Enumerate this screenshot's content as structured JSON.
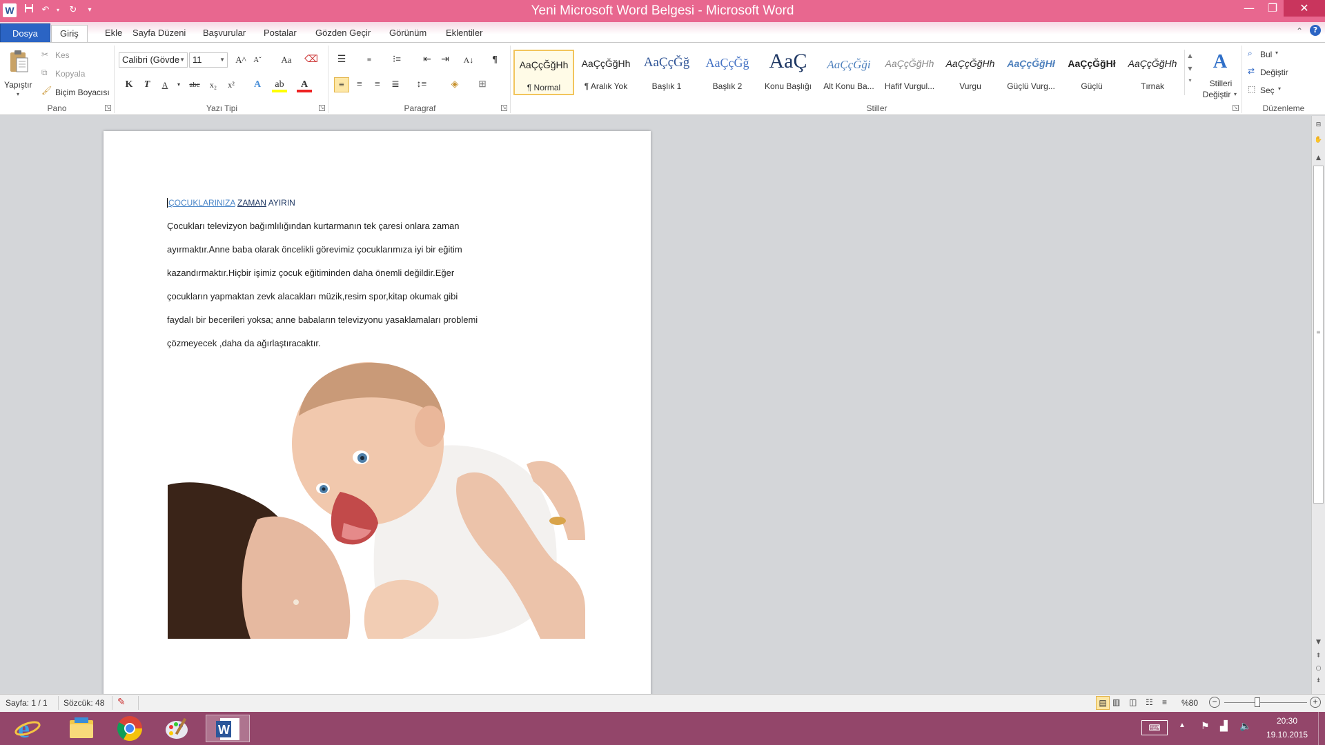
{
  "window": {
    "title": "Yeni Microsoft Word Belgesi  -  Microsoft Word",
    "app_logo": "W",
    "quick_access": [
      "save-icon",
      "undo-icon",
      "redo-icon",
      "customize-icon"
    ],
    "controls": [
      "minimize-icon",
      "restore-icon",
      "close-icon"
    ]
  },
  "tabs": {
    "file": "Dosya",
    "items": [
      "Giriş",
      "Ekle",
      "Sayfa Düzeni",
      "Başvurular",
      "Postalar",
      "Gözden Geçir",
      "Görünüm",
      "Eklentiler"
    ]
  },
  "ribbon": {
    "clipboard": {
      "label": "Pano",
      "paste": "Yapıştır",
      "cut": "Kes",
      "copy": "Kopyala",
      "format_painter": "Biçim Boyacısı"
    },
    "font": {
      "label": "Yazı Tipi",
      "family": "Calibri (Gövde",
      "size": "11",
      "bold": "K",
      "italic": "T",
      "underline": "A",
      "strike": "abc",
      "subscript": "x₂",
      "superscript": "x²",
      "grow": "A^",
      "shrink": "Aˇ",
      "case": "Aa"
    },
    "paragraph": {
      "label": "Paragraf",
      "pilcrow": "¶"
    },
    "styles": {
      "label": "Stiller",
      "items": [
        {
          "sample": "AaÇçĞğHh",
          "name": "¶ Normal",
          "selected": true
        },
        {
          "sample": "AaÇçĞğHh",
          "name": "¶ Aralık Yok"
        },
        {
          "sample": "AaÇçĞğ",
          "name": "Başlık 1"
        },
        {
          "sample": "AaÇçĞğ",
          "name": "Başlık 2"
        },
        {
          "sample": "AaÇ",
          "name": "Konu Başlığı"
        },
        {
          "sample": "AaÇçĞği",
          "name": "Alt Konu Ba..."
        },
        {
          "sample": "AaÇçĞğHh",
          "name": "Hafif Vurgul..."
        },
        {
          "sample": "AaÇçĞğHh",
          "name": "Vurgu"
        },
        {
          "sample": "AaÇçĞğHł",
          "name": "Güçlü Vurg..."
        },
        {
          "sample": "AaÇçĞğHł",
          "name": "Güçlü"
        },
        {
          "sample": "AaÇçĞğHh",
          "name": "Tırnak"
        }
      ],
      "change_styles_line1": "Stilleri",
      "change_styles_line2": "Değiştir"
    },
    "editing": {
      "label": "Düzenleme",
      "find": "Bul",
      "replace": "Değiştir",
      "select": "Seç"
    }
  },
  "document": {
    "title_part1": "ÇOCUKLARINIZA",
    "title_part2": "ZAMAN",
    "title_part3": "AYIRIN",
    "lines": [
      "Çocukları televizyon bağımlılığından kurtarmanın tek çaresi onlara zaman",
      "ayırmaktır.Anne baba olarak öncelikli görevimiz çocuklarımıza  iyi bir  eğitim",
      "kazandırmaktır.Hiçbir işimiz  çocuk eğitiminden daha önemli değildir.Eğer",
      "çocukların yapmaktan zevk alacakları müzik,resim spor,kitap okumak gibi",
      "faydalı bir becerileri yoksa; anne babaların televizyonu yasaklamaları problemi",
      "çözmeyecek ,daha da ağırlaştıracaktır."
    ]
  },
  "status": {
    "page": "Sayfa: 1 / 1",
    "words": "Sözcük: 48",
    "zoom": "%80",
    "zoom_level": 0.8
  },
  "taskbar": {
    "apps": [
      "internet-explorer-icon",
      "file-explorer-icon",
      "chrome-icon",
      "paint-icon",
      "word-icon"
    ],
    "time": "20:30",
    "date": "19.10.2015"
  },
  "colors": {
    "titlebar": "#e8678f",
    "file_tab": "#2b64c4",
    "taskbar": "#93466a"
  }
}
